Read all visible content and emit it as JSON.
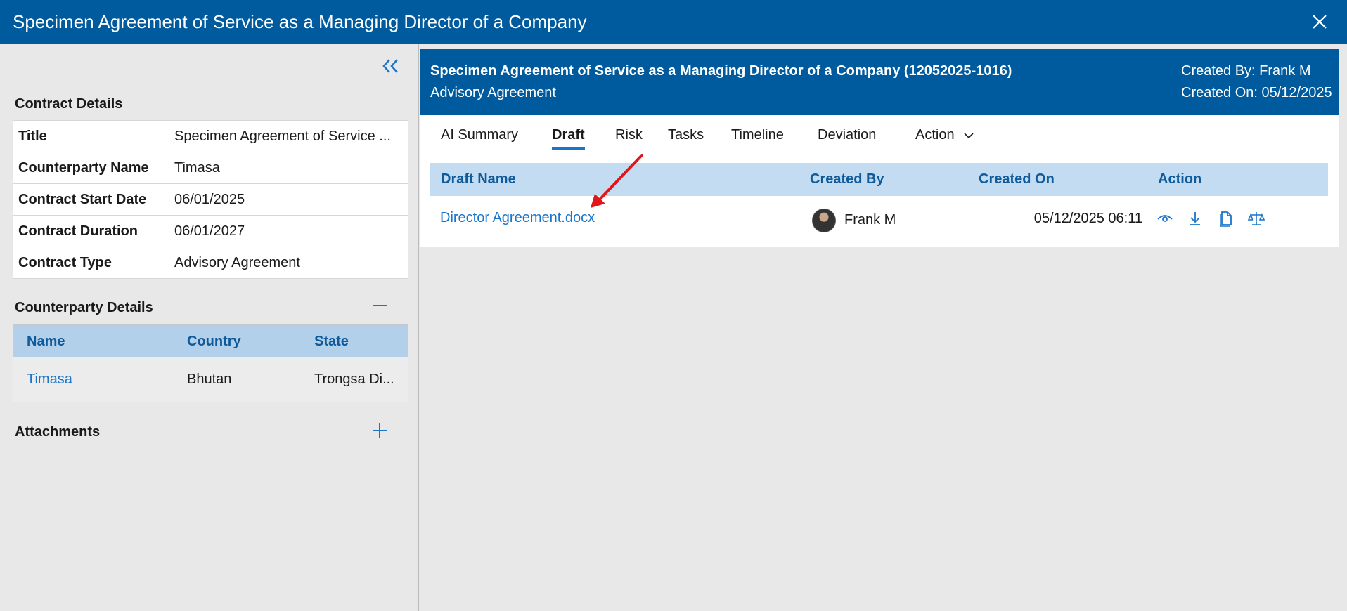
{
  "window": {
    "title": "Specimen Agreement of Service as a Managing Director of a Company"
  },
  "left": {
    "contract_details_title": "Contract Details",
    "details": [
      {
        "key": "Title",
        "value": "Specimen Agreement of Service ..."
      },
      {
        "key": "Counterparty Name",
        "value": "Timasa"
      },
      {
        "key": "Contract Start Date",
        "value": "06/01/2025"
      },
      {
        "key": "Contract Duration",
        "value": "06/01/2027"
      },
      {
        "key": "Contract Type",
        "value": "Advisory Agreement"
      }
    ],
    "counterparty_title": "Counterparty Details",
    "counterparty_columns": [
      "Name",
      "Country",
      "State"
    ],
    "counterparty_rows": [
      {
        "name": "Timasa",
        "country": "Bhutan",
        "state": "Trongsa Di..."
      }
    ],
    "attachments_title": "Attachments"
  },
  "panel": {
    "title": "Specimen Agreement of Service as a Managing Director of a Company (12052025-1016)",
    "subtitle": "Advisory Agreement",
    "created_by": "Created By: Frank M",
    "created_on": "Created On: 05/12/2025",
    "tabs": [
      "AI Summary",
      "Draft",
      "Risk",
      "Tasks",
      "Timeline",
      "Deviation",
      "Action"
    ],
    "active_tab": "Draft",
    "draft_columns": [
      "Draft Name",
      "Created By",
      "Created On",
      "Action"
    ],
    "draft_rows": [
      {
        "name": "Director Agreement.docx",
        "created_by": "Frank M",
        "created_on": "05/12/2025 06:11"
      }
    ],
    "action_icons": [
      "eye-icon",
      "download-icon",
      "document-icon",
      "scale-icon"
    ]
  },
  "colors": {
    "brand": "#005a9e",
    "link": "#1a74c9",
    "header_bg": "#c4dcf2",
    "annotation_arrow": "#e0161b"
  }
}
